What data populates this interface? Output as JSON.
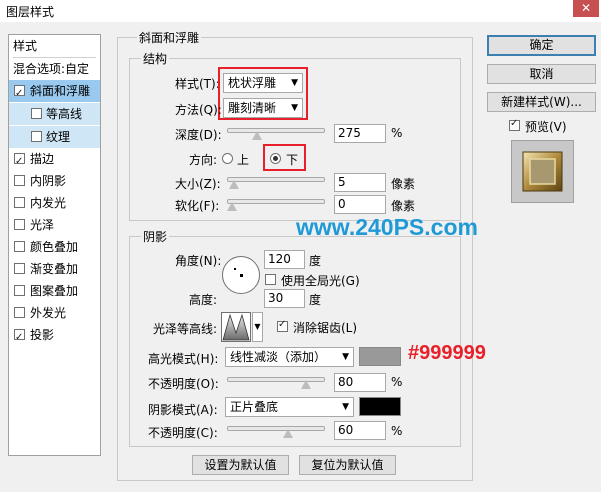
{
  "window": {
    "title": "图层样式",
    "close_glyph": "✕"
  },
  "left_panel": {
    "header": "样式",
    "blend_options": "混合选项:自定",
    "items": [
      {
        "label": "斜面和浮雕",
        "checked": true
      },
      {
        "label": "等高线",
        "checked": false
      },
      {
        "label": "纹理",
        "checked": false
      },
      {
        "label": "描边",
        "checked": true
      },
      {
        "label": "内阴影",
        "checked": false
      },
      {
        "label": "内发光",
        "checked": false
      },
      {
        "label": "光泽",
        "checked": false
      },
      {
        "label": "颜色叠加",
        "checked": false
      },
      {
        "label": "渐变叠加",
        "checked": false
      },
      {
        "label": "图案叠加",
        "checked": false
      },
      {
        "label": "外发光",
        "checked": false
      },
      {
        "label": "投影",
        "checked": true
      }
    ]
  },
  "bevel": {
    "group_title": "斜面和浮雕",
    "structure": {
      "title": "结构",
      "style_label": "样式(T):",
      "style_value": "枕状浮雕",
      "technique_label": "方法(Q):",
      "technique_value": "雕刻清晰",
      "depth_label": "深度(D):",
      "depth_value": "275",
      "depth_unit": "%",
      "depth_fraction": 0.27,
      "direction_label": "方向:",
      "direction_up": "上",
      "direction_down": "下",
      "direction_selected": "下",
      "size_label": "大小(Z):",
      "size_value": "5",
      "size_unit": "像素",
      "size_fraction": 0.02,
      "soften_label": "软化(F):",
      "soften_value": "0",
      "soften_unit": "像素",
      "soften_fraction": 0.0
    },
    "shading": {
      "title": "阴影",
      "angle_label": "角度(N):",
      "angle_value": "120",
      "angle_unit": "度",
      "global_light_label": "使用全局光(G)",
      "global_light_checked": false,
      "altitude_label": "高度:",
      "altitude_value": "30",
      "altitude_unit": "度",
      "gloss_contour_label": "光泽等高线:",
      "antialias_label": "消除锯齿(L)",
      "antialias_checked": true,
      "highlight_mode_label": "高光模式(H):",
      "highlight_mode_value": "线性减淡（添加）",
      "highlight_color": "#999999",
      "highlight_color_annotation": "#999999",
      "highlight_opacity_label": "不透明度(O):",
      "highlight_opacity_value": "80",
      "highlight_opacity_unit": "%",
      "highlight_opacity_fraction": 0.8,
      "shadow_mode_label": "阴影模式(A):",
      "shadow_mode_value": "正片叠底",
      "shadow_color": "#000000",
      "shadow_opacity_label": "不透明度(C):",
      "shadow_opacity_value": "60",
      "shadow_opacity_unit": "%",
      "shadow_opacity_fraction": 0.6
    },
    "make_default": "设置为默认值",
    "reset_default": "复位为默认值"
  },
  "watermark": "www.240PS.com",
  "right_panel": {
    "ok": "确定",
    "cancel": "取消",
    "new_style": "新建样式(W)...",
    "preview_label": "预览(V)",
    "preview_checked": true
  },
  "colors": {
    "accent_red": "#e8202a",
    "watermark_blue": "#1f9ad6",
    "selection_blue": "#99c9ef"
  }
}
